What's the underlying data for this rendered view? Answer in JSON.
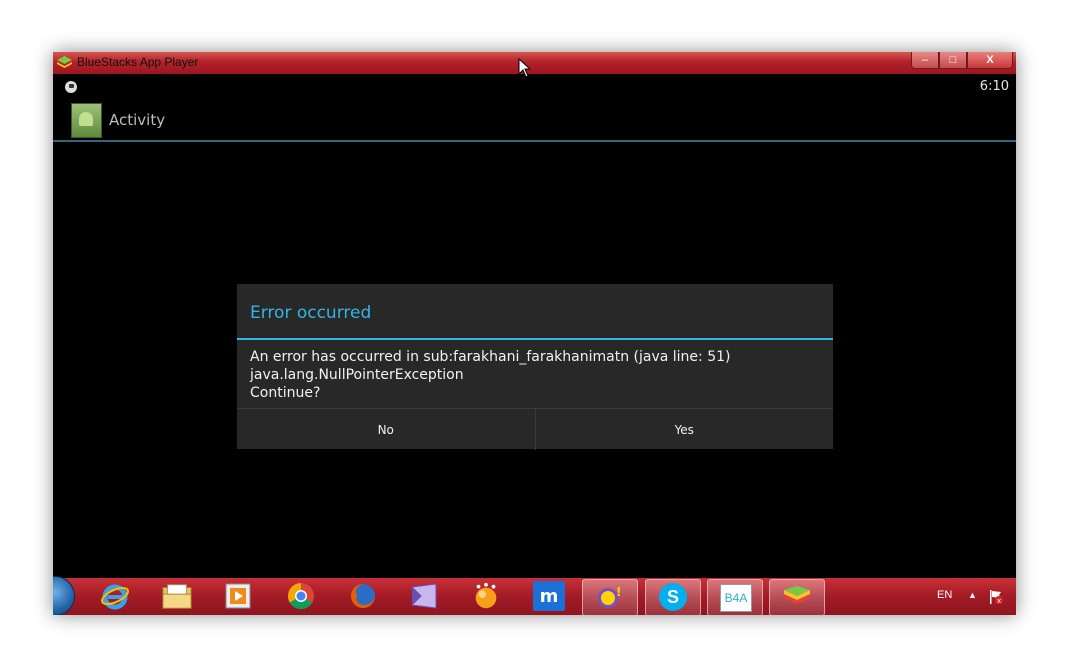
{
  "window": {
    "title": "BlueStacks App Player",
    "buttons": {
      "minimize": "‒",
      "maximize": "□",
      "close": "X"
    }
  },
  "statusbar": {
    "time": "6:10"
  },
  "actionbar": {
    "title": "Activity"
  },
  "dialog": {
    "title": "Error occurred",
    "message": [
      "An error has occurred in sub:farakhani_farakhanimatn (java line: 51)",
      "java.lang.NullPointerException",
      "Continue?"
    ],
    "buttons": {
      "no": "No",
      "yes": "Yes"
    }
  },
  "taskbar": {
    "apps": [
      "start-icon",
      "internet-explorer-icon",
      "file-explorer-icon",
      "media-player-icon",
      "chrome-icon",
      "firefox-icon",
      "visual-studio-icon",
      "vlc-icon",
      "maxthon-icon",
      "yahoo-messenger-icon",
      "skype-icon",
      "b4a-icon",
      "bluestacks-icon"
    ],
    "b4a_label": "B4A",
    "maxthon_label": "m",
    "skype_label": "S",
    "language": "EN"
  },
  "colors": {
    "accent": "#33b5e5",
    "dialog_bg": "#282828",
    "titlebar": "#b2222a"
  }
}
